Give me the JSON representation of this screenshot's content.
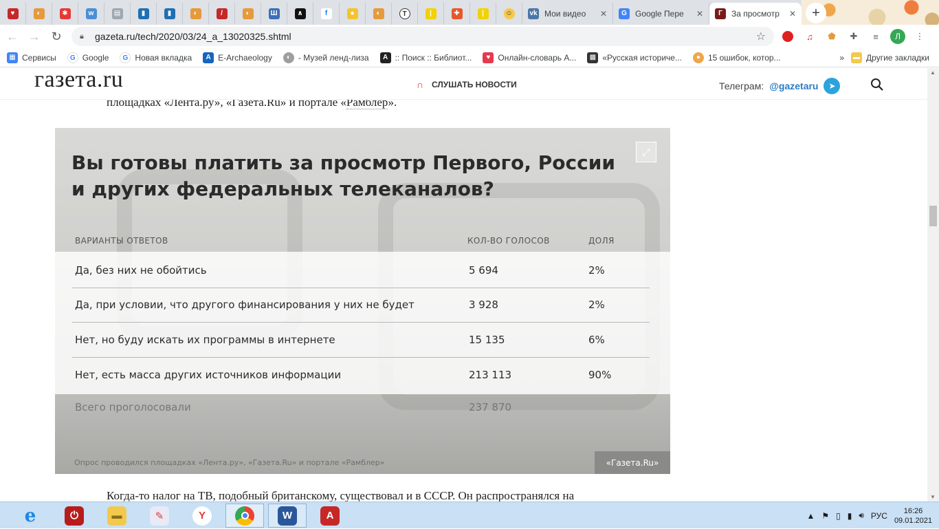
{
  "browser": {
    "tabs": [
      {
        "label": "Мои видео"
      },
      {
        "label": "Google Пере"
      },
      {
        "label": "За просмотр"
      }
    ],
    "new_tab": "+",
    "url": "gazeta.ru/tech/2020/03/24_a_13020325.shtml",
    "profile_initial": "Л"
  },
  "bookmarks": {
    "items": [
      {
        "label": "Сервисы"
      },
      {
        "label": "Google"
      },
      {
        "label": "Новая вкладка"
      },
      {
        "label": "E-Archaeology"
      },
      {
        "label": "- Музей ленд-лиза"
      },
      {
        "label": ":: Поиск :: Библиот..."
      },
      {
        "label": "Онлайн-словарь А..."
      },
      {
        "label": "«Русская историче..."
      },
      {
        "label": "15 ошибок, котор..."
      }
    ],
    "more": "»",
    "other": "Другие закладки"
  },
  "site": {
    "logo": "газета.ru",
    "listen": "СЛУШАТЬ НОВОСТИ",
    "telegram_label": "Телеграм:",
    "telegram_handle": "@gazetaru"
  },
  "article": {
    "intro_before": "площадках «Лента.ру», «Газета.Ru» и портале «",
    "intro_link": "Рамблер",
    "intro_after": "».",
    "outro": "Когда-то налог на ТВ, подобный британскому, существовал и в СССР. Он распространялся на"
  },
  "infographic": {
    "title_line1": "Вы готовы платить за просмотр Первого, России",
    "title_line2": "и других федеральных телеканалов?",
    "col_option": "ВАРИАНТЫ ОТВЕТОВ",
    "col_votes": "КОЛ-ВО ГОЛОСОВ",
    "col_share": "ДОЛЯ",
    "rows": [
      {
        "option": "Да, без них не обойтись",
        "votes": "5 694",
        "share": "2%"
      },
      {
        "option": "Да, при условии, что другого финансирования у них не будет",
        "votes": "3 928",
        "share": "2%"
      },
      {
        "option": "Нет, но буду искать их программы в интернете",
        "votes": "15 135",
        "share": "6%"
      },
      {
        "option": "Нет, есть масса других источников информации",
        "votes": "213 113",
        "share": "90%"
      }
    ],
    "total_label": "Всего проголосовали",
    "total_value": "237 870",
    "footnote": "Опрос проводился площадках «Лента.ру», «Газета.Ru» и портале «Рамблер»",
    "brand": "«Газета.Ru»"
  },
  "taskbar": {
    "lang": "РУС",
    "time": "16:26",
    "date": "09.01.2021"
  },
  "colors": {
    "accent_red": "#e4362c",
    "telegram_blue": "#2aa3de"
  }
}
